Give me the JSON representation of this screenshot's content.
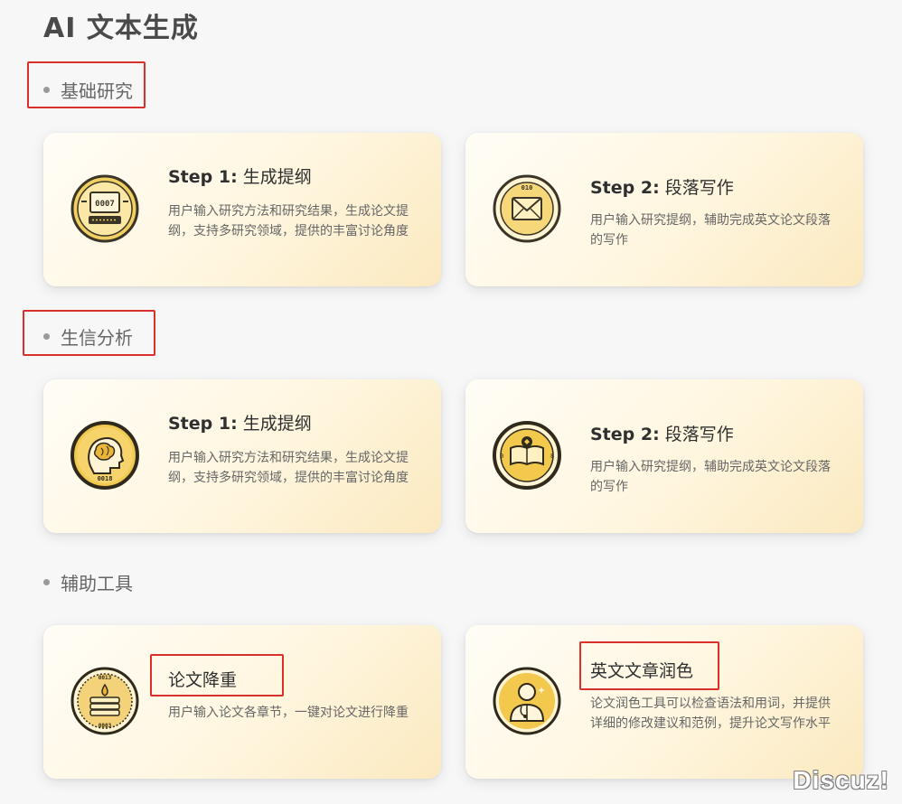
{
  "page": {
    "title": "AI 文本生成"
  },
  "sections": [
    {
      "label": "基础研究",
      "cards": [
        {
          "step": "Step 1:",
          "title": "生成提纲",
          "desc": "用户输入研究方法和研究结果，生成论文提纲，支持多研究领域，提供的丰富讨论角度",
          "icon": "computer-icon",
          "badge": "0007"
        },
        {
          "step": "Step 2:",
          "title": "段落写作",
          "desc": "用户输入研究提纲，辅助完成英文论文段落的写作",
          "icon": "envelope-icon",
          "badge": "010"
        }
      ]
    },
    {
      "label": "生信分析",
      "cards": [
        {
          "step": "Step 1:",
          "title": "生成提纲",
          "desc": "用户输入研究方法和研究结果，生成论文提纲，支持多研究领域，提供的丰富讨论角度",
          "icon": "brain-head-icon",
          "badge": "0018"
        },
        {
          "step": "Step 2:",
          "title": "段落写作",
          "desc": "用户输入研究提纲，辅助完成英文论文段落的写作",
          "icon": "book-icon",
          "badge_left": "0",
          "badge_right": "8"
        }
      ]
    },
    {
      "label": "辅助工具",
      "cards": [
        {
          "title": "论文降重",
          "desc": "用户输入论文各章节，一键对论文进行降重",
          "icon": "paper-stack-icon",
          "badge_top": "0013",
          "badge_bottom": "0003"
        },
        {
          "title": "英文文章润色",
          "desc": "论文润色工具可以检查语法和用词，并提供详细的修改建议和范例，提升论文写作水平",
          "icon": "doctor-icon"
        }
      ]
    }
  ],
  "watermark": "Discuz!",
  "colors": {
    "accent_red": "#d9302c",
    "icon_gold": "#e8b73a",
    "icon_dark": "#3a3526",
    "card_bg_start": "#fffdf7",
    "card_bg_end": "#fbe9bf"
  }
}
